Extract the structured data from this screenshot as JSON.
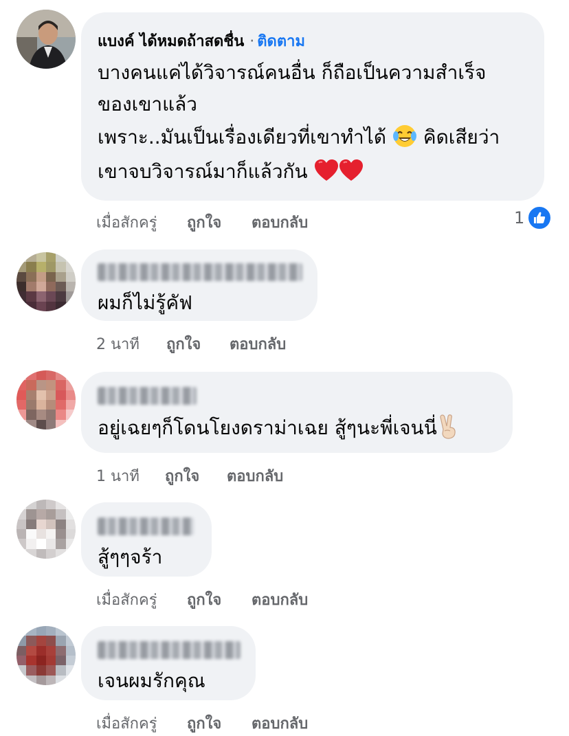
{
  "comments": [
    {
      "author": "แบงค์ ได้หมดถ้าสดชื่น",
      "separator": "·",
      "follow_label": "ติดตาม",
      "lines": [
        "บางคนแค่ได้วิจารณ์คนอื่น ก็ถือเป็นความสำเร็จ",
        "ของเขาแล้ว",
        "เพราะ..มันเป็นเรื่องเดียวที่เขาทำได้",
        "คิดเสียว่า",
        "เขาจบวิจารณ์มาก็แล้วกัน"
      ],
      "emojis": [
        "face-with-tears-of-joy",
        "red-heart",
        "red-heart"
      ],
      "time": "เมื่อสักครู่",
      "like_label": "ถูกใจ",
      "reply_label": "ตอบกลับ",
      "reaction_count": "1",
      "reaction_icon": "like-icon"
    },
    {
      "author_blurred": true,
      "lines": [
        "ผมก็ไม่รู้คัฟ"
      ],
      "time": "2 นาที",
      "like_label": "ถูกใจ",
      "reply_label": "ตอบกลับ"
    },
    {
      "author_blurred": true,
      "lines": [
        "อยู่เฉยๆก็โดนโยงดราม่าเฉย สู้ๆนะพี่เจนนี่"
      ],
      "emojis": [
        "victory-hand"
      ],
      "time": "1 นาที",
      "like_label": "ถูกใจ",
      "reply_label": "ตอบกลับ"
    },
    {
      "author_blurred": true,
      "lines": [
        "สู้ๆๆจร้า"
      ],
      "time": "เมื่อสักครู่",
      "like_label": "ถูกใจ",
      "reply_label": "ตอบกลับ"
    },
    {
      "author_blurred": true,
      "lines": [
        "เจนผมรักคุณ"
      ],
      "time": "เมื่อสักครู่",
      "like_label": "ถูกใจ",
      "reply_label": "ตอบกลับ"
    }
  ],
  "colors": {
    "bubble_bg": "#f0f2f5",
    "meta_text": "#65676b",
    "follow_link": "#1877f2",
    "like_badge": "#1877f2"
  }
}
